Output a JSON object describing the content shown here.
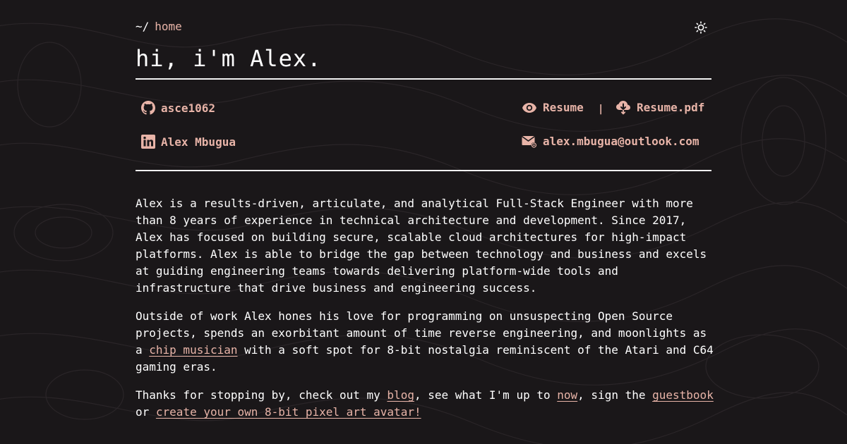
{
  "breadcrumb": {
    "prefix": "~/",
    "current": "home"
  },
  "title": "hi, i'm Alex.",
  "links": {
    "github": "asce1062",
    "linkedin": "Alex Mbugua",
    "resume": "Resume",
    "separator": "|",
    "resume_pdf": "Resume.pdf",
    "email": "alex.mbugua@outlook.com"
  },
  "bio": {
    "p1": "Alex is a results-driven, articulate, and analytical Full-Stack Engineer with more than 8 years of experience in technical architecture and development. Since 2017, Alex has focused on building secure, scalable cloud architectures for high-impact platforms. Alex is able to bridge the gap between technology and business and excels at guiding engineering teams towards delivering platform-wide tools and infrastructure that drive business and engineering success.",
    "p2_a": "Outside of work Alex hones his love for programming on unsuspecting Open Source projects, spends an exorbitant amount of time reverse engineering, and moonlights as a ",
    "p2_link": "chip musician",
    "p2_b": " with a soft spot for 8-bit nostalgia reminiscent of the Atari and C64 gaming eras.",
    "p3_a": "Thanks for stopping by, check out my ",
    "p3_blog": "blog",
    "p3_b": ", see what I'm up to ",
    "p3_now": "now",
    "p3_c": ", sign the ",
    "p3_guestbook": "guestbook",
    "p3_d": " or ",
    "p3_avatar": "create your own 8-bit pixel art avatar!"
  },
  "colors": {
    "background": "#1a1719",
    "accent": "#e8b4a8",
    "text": "#ffffff"
  },
  "icons": [
    "sun-icon",
    "github-icon",
    "linkedin-icon",
    "eye-icon",
    "cloud-download-icon",
    "mail-icon"
  ]
}
